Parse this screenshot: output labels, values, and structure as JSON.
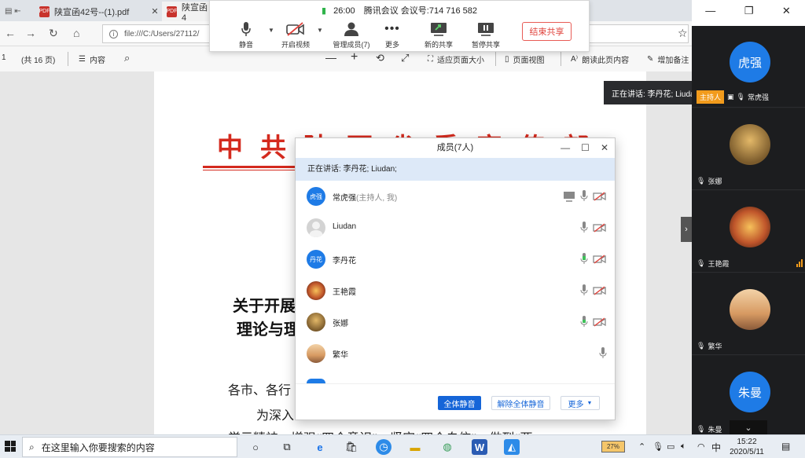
{
  "browser": {
    "tabs": [
      {
        "label": "陕宣函42号--(1).pdf"
      },
      {
        "label": "陕宣函4"
      }
    ],
    "url": "file:///C:/Users/27112/"
  },
  "pdf_toolbar": {
    "page_number": "1",
    "page_total": "(共 16 页)",
    "toc_label": "内容",
    "fit_page_label": "适应页面大小",
    "page_view_label": "页面视图",
    "read_aloud_label": "朗读此页内容",
    "annotate_label": "增加备注"
  },
  "document": {
    "title": "中共陕西省委宣传部",
    "heading_line1": "关于开展",
    "heading_line2": "理论与理",
    "para1": "各市、各行",
    "para2": "为深入",
    "para3": "学示精神，增强“四个意识”，坚定“四个自信”，做到“两"
  },
  "meeting": {
    "time": "26:00",
    "app_name": "腾讯会议",
    "meeting_id_label": "会议号:",
    "meeting_id": "714 716 582",
    "buttons": {
      "mute": "静音",
      "video": "开启视频",
      "members": "管理成员(7)",
      "more": "更多",
      "new_share": "新的共享",
      "pause_share": "暂停共享",
      "end_share": "结束共享"
    }
  },
  "right_panel": {
    "speaking_tip": "正在讲话: 李丹花; Liudan",
    "host_badge": "主持人",
    "tiles": [
      {
        "name": "常虎强",
        "avatar_text": "虎强",
        "color": "#1e7be6"
      },
      {
        "name": "张娜",
        "avatar_text": "",
        "color": "#8a6d3b"
      },
      {
        "name": "王艳霞",
        "avatar_text": "",
        "color": "#c0562b"
      },
      {
        "name": "繁华",
        "avatar_text": "",
        "color": "#d79a62"
      },
      {
        "name": "朱曼",
        "avatar_text": "朱曼",
        "color": "#1e7be6"
      }
    ]
  },
  "members_dialog": {
    "title": "成员(7人)",
    "speaking": "正在讲话: 李丹花; Liudan;",
    "members": [
      {
        "name": "常虎强",
        "role": "(主持人, 我)",
        "avatar_text": "虎强",
        "avatar_color": "#1e7be6"
      },
      {
        "name": "Liudan",
        "role": "",
        "avatar_text": "",
        "avatar_color": "#cfcfcf"
      },
      {
        "name": "李丹花",
        "role": "",
        "avatar_text": "丹花",
        "avatar_color": "#1e7be6"
      },
      {
        "name": "王艳霞",
        "role": "",
        "avatar_text": "",
        "avatar_color": "#c0562b"
      },
      {
        "name": "张娜",
        "role": "",
        "avatar_text": "",
        "avatar_color": "#8a6d3b"
      },
      {
        "name": "繁华",
        "role": "",
        "avatar_text": "",
        "avatar_color": "#d79a62"
      }
    ],
    "mute_all": "全体静音",
    "unmute_all": "解除全体静音",
    "more": "更多"
  },
  "taskbar": {
    "search_placeholder": "在这里输入你要搜索的内容",
    "battery": "27%",
    "ime": "中",
    "time": "15:22",
    "date": "2020/5/11"
  }
}
